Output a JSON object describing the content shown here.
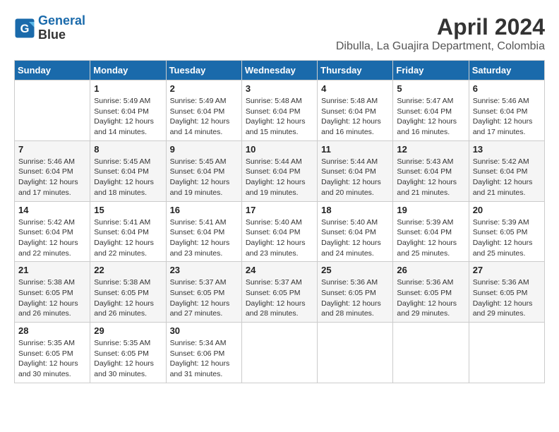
{
  "header": {
    "logo_line1": "General",
    "logo_line2": "Blue",
    "month_year": "April 2024",
    "location": "Dibulla, La Guajira Department, Colombia"
  },
  "days_of_week": [
    "Sunday",
    "Monday",
    "Tuesday",
    "Wednesday",
    "Thursday",
    "Friday",
    "Saturday"
  ],
  "weeks": [
    [
      {
        "num": "",
        "detail": ""
      },
      {
        "num": "1",
        "detail": "Sunrise: 5:49 AM\nSunset: 6:04 PM\nDaylight: 12 hours\nand 14 minutes."
      },
      {
        "num": "2",
        "detail": "Sunrise: 5:49 AM\nSunset: 6:04 PM\nDaylight: 12 hours\nand 14 minutes."
      },
      {
        "num": "3",
        "detail": "Sunrise: 5:48 AM\nSunset: 6:04 PM\nDaylight: 12 hours\nand 15 minutes."
      },
      {
        "num": "4",
        "detail": "Sunrise: 5:48 AM\nSunset: 6:04 PM\nDaylight: 12 hours\nand 16 minutes."
      },
      {
        "num": "5",
        "detail": "Sunrise: 5:47 AM\nSunset: 6:04 PM\nDaylight: 12 hours\nand 16 minutes."
      },
      {
        "num": "6",
        "detail": "Sunrise: 5:46 AM\nSunset: 6:04 PM\nDaylight: 12 hours\nand 17 minutes."
      }
    ],
    [
      {
        "num": "7",
        "detail": "Sunrise: 5:46 AM\nSunset: 6:04 PM\nDaylight: 12 hours\nand 17 minutes."
      },
      {
        "num": "8",
        "detail": "Sunrise: 5:45 AM\nSunset: 6:04 PM\nDaylight: 12 hours\nand 18 minutes."
      },
      {
        "num": "9",
        "detail": "Sunrise: 5:45 AM\nSunset: 6:04 PM\nDaylight: 12 hours\nand 19 minutes."
      },
      {
        "num": "10",
        "detail": "Sunrise: 5:44 AM\nSunset: 6:04 PM\nDaylight: 12 hours\nand 19 minutes."
      },
      {
        "num": "11",
        "detail": "Sunrise: 5:44 AM\nSunset: 6:04 PM\nDaylight: 12 hours\nand 20 minutes."
      },
      {
        "num": "12",
        "detail": "Sunrise: 5:43 AM\nSunset: 6:04 PM\nDaylight: 12 hours\nand 21 minutes."
      },
      {
        "num": "13",
        "detail": "Sunrise: 5:42 AM\nSunset: 6:04 PM\nDaylight: 12 hours\nand 21 minutes."
      }
    ],
    [
      {
        "num": "14",
        "detail": "Sunrise: 5:42 AM\nSunset: 6:04 PM\nDaylight: 12 hours\nand 22 minutes."
      },
      {
        "num": "15",
        "detail": "Sunrise: 5:41 AM\nSunset: 6:04 PM\nDaylight: 12 hours\nand 22 minutes."
      },
      {
        "num": "16",
        "detail": "Sunrise: 5:41 AM\nSunset: 6:04 PM\nDaylight: 12 hours\nand 23 minutes."
      },
      {
        "num": "17",
        "detail": "Sunrise: 5:40 AM\nSunset: 6:04 PM\nDaylight: 12 hours\nand 23 minutes."
      },
      {
        "num": "18",
        "detail": "Sunrise: 5:40 AM\nSunset: 6:04 PM\nDaylight: 12 hours\nand 24 minutes."
      },
      {
        "num": "19",
        "detail": "Sunrise: 5:39 AM\nSunset: 6:04 PM\nDaylight: 12 hours\nand 25 minutes."
      },
      {
        "num": "20",
        "detail": "Sunrise: 5:39 AM\nSunset: 6:05 PM\nDaylight: 12 hours\nand 25 minutes."
      }
    ],
    [
      {
        "num": "21",
        "detail": "Sunrise: 5:38 AM\nSunset: 6:05 PM\nDaylight: 12 hours\nand 26 minutes."
      },
      {
        "num": "22",
        "detail": "Sunrise: 5:38 AM\nSunset: 6:05 PM\nDaylight: 12 hours\nand 26 minutes."
      },
      {
        "num": "23",
        "detail": "Sunrise: 5:37 AM\nSunset: 6:05 PM\nDaylight: 12 hours\nand 27 minutes."
      },
      {
        "num": "24",
        "detail": "Sunrise: 5:37 AM\nSunset: 6:05 PM\nDaylight: 12 hours\nand 28 minutes."
      },
      {
        "num": "25",
        "detail": "Sunrise: 5:36 AM\nSunset: 6:05 PM\nDaylight: 12 hours\nand 28 minutes."
      },
      {
        "num": "26",
        "detail": "Sunrise: 5:36 AM\nSunset: 6:05 PM\nDaylight: 12 hours\nand 29 minutes."
      },
      {
        "num": "27",
        "detail": "Sunrise: 5:36 AM\nSunset: 6:05 PM\nDaylight: 12 hours\nand 29 minutes."
      }
    ],
    [
      {
        "num": "28",
        "detail": "Sunrise: 5:35 AM\nSunset: 6:05 PM\nDaylight: 12 hours\nand 30 minutes."
      },
      {
        "num": "29",
        "detail": "Sunrise: 5:35 AM\nSunset: 6:05 PM\nDaylight: 12 hours\nand 30 minutes."
      },
      {
        "num": "30",
        "detail": "Sunrise: 5:34 AM\nSunset: 6:06 PM\nDaylight: 12 hours\nand 31 minutes."
      },
      {
        "num": "",
        "detail": ""
      },
      {
        "num": "",
        "detail": ""
      },
      {
        "num": "",
        "detail": ""
      },
      {
        "num": "",
        "detail": ""
      }
    ]
  ]
}
